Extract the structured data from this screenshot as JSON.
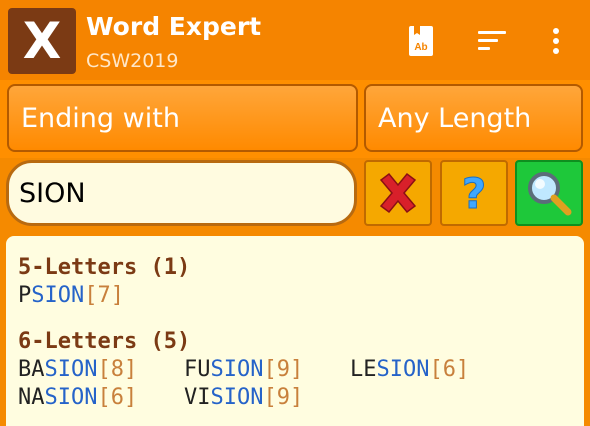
{
  "app": {
    "logo_letter": "X",
    "title": "Word Expert",
    "subtitle": "CSW2019"
  },
  "actions": {
    "dictionary_icon": "dictionary-icon",
    "dictionary_label": "Ab",
    "sort_icon": "sort-icon",
    "more_icon": "more-vert-icon"
  },
  "filters": {
    "mode": "Ending with",
    "length": "Any Length"
  },
  "search": {
    "value": "SION"
  },
  "colors": {
    "appbar": "#f58400",
    "accent_brown": "#7b3a14",
    "result_bg": "#fffde0",
    "suffix_blue": "#2563c9",
    "score_tan": "#c8803c",
    "search_green": "#1ec83a"
  },
  "results": [
    {
      "header": "5-Letters (1)",
      "words": [
        {
          "prefix": "P",
          "suffix": "SION",
          "score": "[7]"
        }
      ]
    },
    {
      "header": "6-Letters (5)",
      "words": [
        {
          "prefix": "BA",
          "suffix": "SION",
          "score": "[8]"
        },
        {
          "prefix": "FU",
          "suffix": "SION",
          "score": "[9]"
        },
        {
          "prefix": "LE",
          "suffix": "SION",
          "score": "[6]"
        },
        {
          "prefix": "NA",
          "suffix": "SION",
          "score": "[6]"
        },
        {
          "prefix": "VI",
          "suffix": "SION",
          "score": "[9]"
        }
      ]
    }
  ]
}
